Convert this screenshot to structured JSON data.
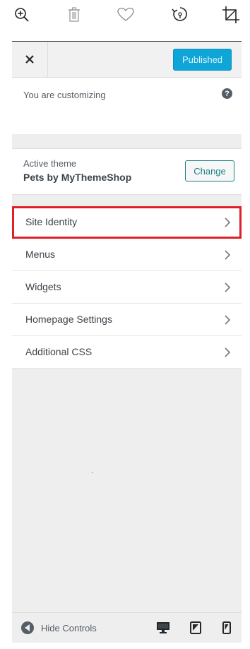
{
  "toolbar": {
    "icons": [
      "zoom-in-icon",
      "trash-icon",
      "heart-icon",
      "rotate-icon",
      "crop-icon"
    ]
  },
  "header": {
    "close_label": "×",
    "publish_label": "Published",
    "publish_color": "#0ea5d8"
  },
  "info": {
    "label": "You are customizing",
    "help_label": "?"
  },
  "theme": {
    "label": "Active theme",
    "name": "Pets by MyThemeShop",
    "change_label": "Change",
    "accent_color": "#1a7f84"
  },
  "menu": {
    "items": [
      {
        "label": "Site Identity",
        "highlighted": true
      },
      {
        "label": "Menus",
        "highlighted": false
      },
      {
        "label": "Widgets",
        "highlighted": false
      },
      {
        "label": "Homepage Settings",
        "highlighted": false
      },
      {
        "label": "Additional CSS",
        "highlighted": false
      }
    ],
    "highlight_color": "#e01f26"
  },
  "footer": {
    "hide_label": "Hide Controls",
    "devices": [
      "desktop-icon",
      "tablet-icon",
      "mobile-icon"
    ]
  }
}
